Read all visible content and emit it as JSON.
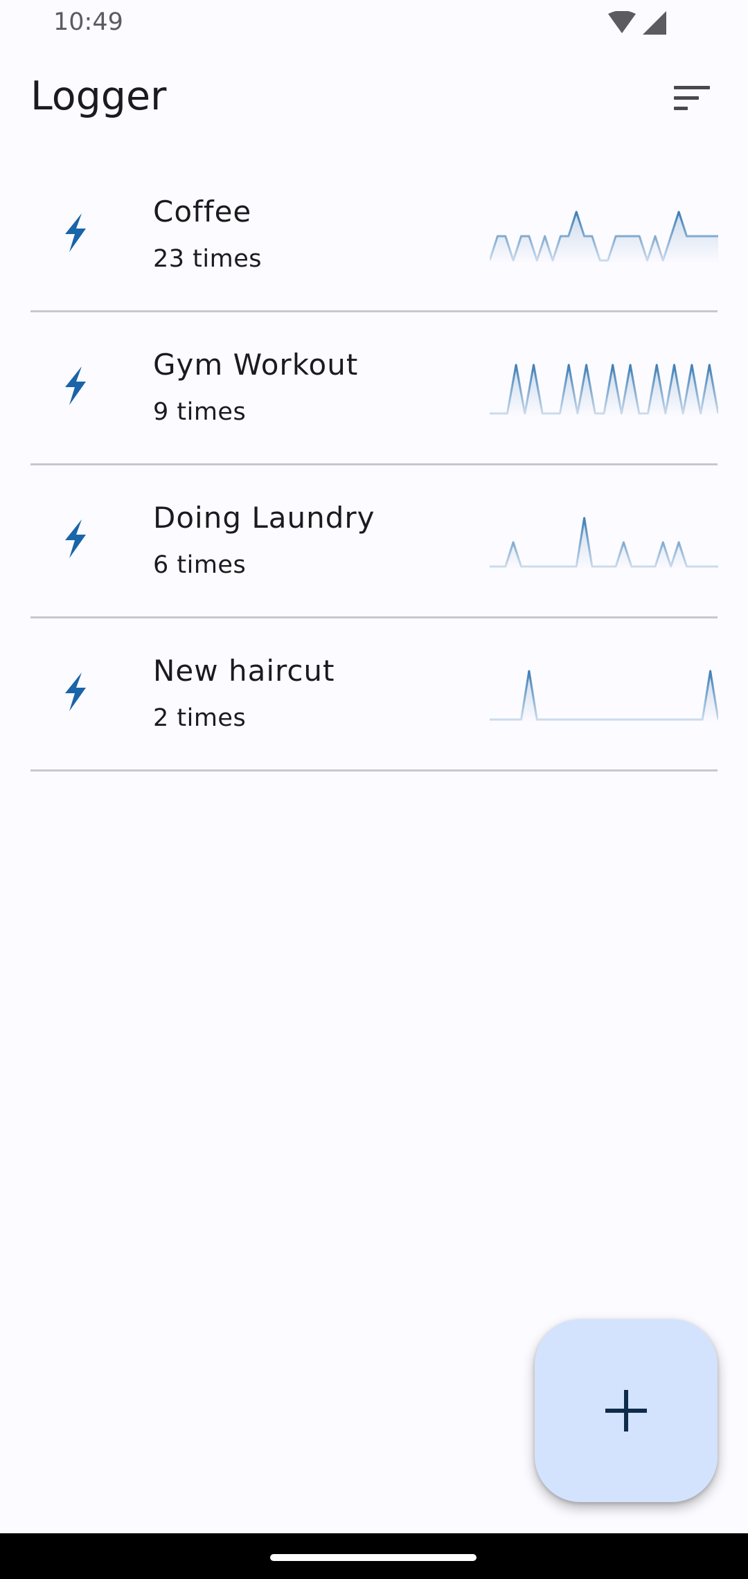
{
  "status_bar": {
    "time": "10:49",
    "icons": [
      "wifi-icon",
      "cellular-signal-icon"
    ]
  },
  "app_bar": {
    "title": "Logger",
    "sort_icon": "sort-icon"
  },
  "colors": {
    "accent": "#1a64a8",
    "sparkline": "#3f7fb6",
    "fab": "#d3e3fd",
    "divider": "#c8c8cc"
  },
  "items": [
    {
      "title": "Coffee",
      "count": "23 times",
      "icon": "bolt-icon"
    },
    {
      "title": "Gym Workout",
      "count": "9 times",
      "icon": "bolt-icon"
    },
    {
      "title": "Doing Laundry",
      "count": "6 times",
      "icon": "bolt-icon"
    },
    {
      "title": "New haircut",
      "count": "2 times",
      "icon": "bolt-icon"
    }
  ],
  "chart_data": [
    {
      "type": "area",
      "name": "Coffee",
      "values": [
        0,
        1,
        1,
        0,
        1,
        1,
        0,
        1,
        0,
        1,
        1,
        2,
        1,
        1,
        0,
        0,
        1,
        1,
        1,
        1,
        0,
        1,
        0,
        1,
        2,
        1,
        1,
        1,
        1,
        1
      ]
    },
    {
      "type": "area",
      "name": "Gym Workout",
      "values": [
        0,
        0,
        0,
        2,
        0,
        2,
        0,
        0,
        0,
        2,
        0,
        2,
        0,
        0,
        2,
        0,
        2,
        0,
        0,
        2,
        0,
        2,
        0,
        2,
        0,
        2,
        0
      ]
    },
    {
      "type": "area",
      "name": "Doing Laundry",
      "values": [
        0,
        0,
        0,
        1,
        0,
        0,
        0,
        0,
        0,
        0,
        0,
        0,
        2,
        0,
        0,
        0,
        0,
        1,
        0,
        0,
        0,
        0,
        1,
        0,
        1,
        0,
        0,
        0,
        0,
        0
      ]
    },
    {
      "type": "area",
      "name": "New haircut",
      "values": [
        0,
        0,
        0,
        0,
        0,
        2,
        0,
        0,
        0,
        0,
        0,
        0,
        0,
        0,
        0,
        0,
        0,
        0,
        0,
        0,
        0,
        0,
        0,
        0,
        0,
        0,
        0,
        0,
        2,
        0
      ]
    }
  ],
  "fab": {
    "icon": "plus-icon"
  }
}
